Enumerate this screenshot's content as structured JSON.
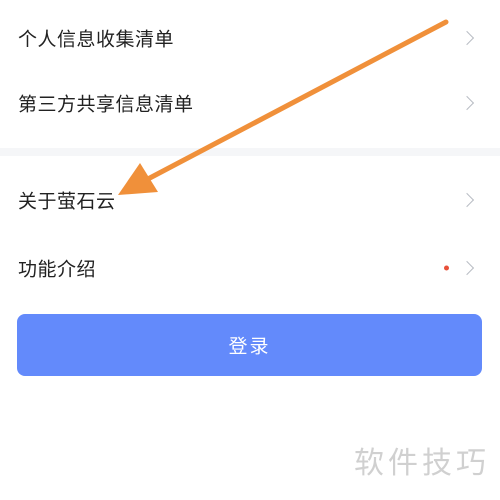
{
  "settings": {
    "items_top": [
      {
        "label": "个人信息收集清单",
        "icon": "chevron-right-icon"
      },
      {
        "label": "第三方共享信息清单",
        "icon": "chevron-right-icon"
      }
    ],
    "items_bottom": [
      {
        "label": "关于萤石云",
        "icon": "chevron-right-icon"
      },
      {
        "label": "功能介绍",
        "icon": "chevron-right-icon",
        "badge": "red-dot"
      }
    ],
    "login_label": "登录"
  },
  "annotation": {
    "type": "arrow",
    "color": "#f0903a",
    "target": "关于萤石云"
  },
  "watermark": "软件技巧",
  "colors": {
    "primary_button": "#638afb",
    "separator": "#f5f6f8",
    "badge": "#e8503a",
    "text": "#222222"
  }
}
